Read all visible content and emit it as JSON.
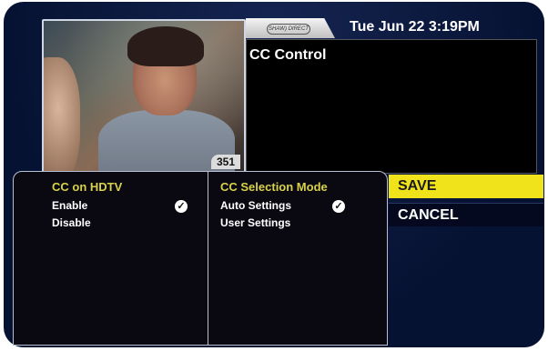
{
  "preview": {
    "channel_number": "351"
  },
  "header": {
    "logo_text": "SHAW) DIRECT",
    "datetime": "Tue Jun 22 3:19PM",
    "panel_title": "CC Control"
  },
  "cc_hdtv": {
    "heading": "CC on HDTV",
    "options": [
      {
        "label": "Enable",
        "selected": true
      },
      {
        "label": "Disable",
        "selected": false
      }
    ]
  },
  "cc_mode": {
    "heading": "CC Selection Mode",
    "options": [
      {
        "label": "Auto Settings",
        "selected": true
      },
      {
        "label": "User Settings",
        "selected": false
      }
    ]
  },
  "actions": {
    "save_label": "SAVE",
    "cancel_label": "CANCEL"
  },
  "colors": {
    "highlight": "#f0e21b",
    "heading": "#d8d24a",
    "background": "#061232"
  }
}
